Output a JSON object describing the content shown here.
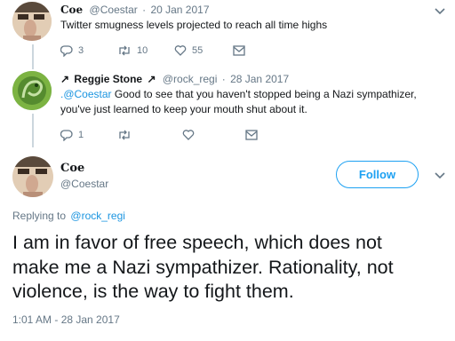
{
  "colors": {
    "accent": "#1da1f2",
    "link": "#1b95e0",
    "muted": "#657786",
    "thread_line": "#ccd6dd"
  },
  "tweet1": {
    "display_name": "Coe",
    "handle": "@Coestar",
    "separator": "·",
    "date": "20 Jan 2017",
    "text": "Twitter smugness levels projected to reach all time highs",
    "actions": {
      "reply_icon": "reply-icon",
      "reply_count": "3",
      "retweet_icon": "retweet-icon",
      "retweet_count": "10",
      "like_icon": "heart-icon",
      "like_count": "55",
      "dm_icon": "envelope-icon"
    }
  },
  "tweet2": {
    "display_name_prefix": "↗",
    "display_name": "Reggie Stone",
    "display_name_suffix": "↗",
    "handle": "@rock_regi",
    "separator": "·",
    "date": "28 Jan 2017",
    "mention": ".@Coestar",
    "text_line1": " Good to see that you haven't stopped being a Nazi sympathizer,",
    "text_line2": "you've just learned to keep your mouth shut about it.",
    "actions": {
      "reply_icon": "reply-icon",
      "reply_count": "1",
      "retweet_icon": "retweet-icon",
      "like_icon": "heart-icon",
      "dm_icon": "envelope-icon"
    }
  },
  "main_tweet": {
    "display_name": "Coe",
    "handle": "@Coestar",
    "follow_label": "Follow",
    "replying_to_label": "Replying to",
    "replying_to_handle": "@rock_regi",
    "text_line1": "I am in favor of free speech, which does not",
    "text_line2": "make me a Nazi sympathizer.  Rationality, not",
    "text_line3": "violence, is the way to fight them.",
    "timestamp": "1:01 AM - 28 Jan 2017"
  }
}
